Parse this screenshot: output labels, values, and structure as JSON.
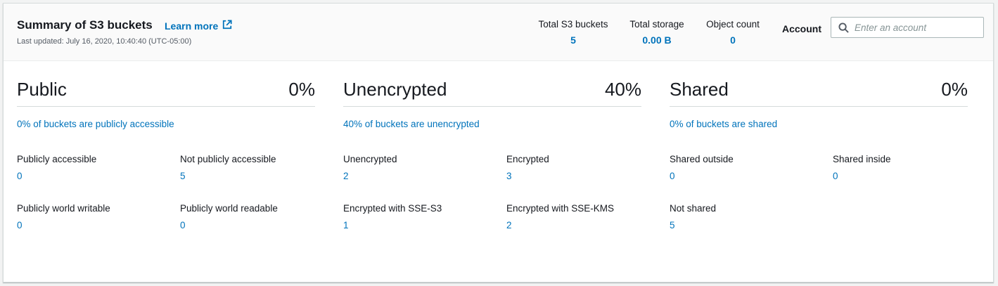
{
  "header": {
    "title": "Summary of S3 buckets",
    "learn_more": "Learn more",
    "last_updated": "Last updated: July 16, 2020, 10:40:40 (UTC-05:00)",
    "stats": [
      {
        "label": "Total S3 buckets",
        "value": "5"
      },
      {
        "label": "Total storage",
        "value": "0.00 B"
      },
      {
        "label": "Object count",
        "value": "0"
      }
    ],
    "account_label": "Account",
    "account_placeholder": "Enter an account",
    "account_value": ""
  },
  "sections": [
    {
      "title": "Public",
      "percent": "0%",
      "link": "0% of buckets are publicly accessible",
      "metrics": [
        {
          "label": "Publicly accessible",
          "value": "0"
        },
        {
          "label": "Not publicly accessible",
          "value": "5"
        },
        {
          "label": "Publicly world writable",
          "value": "0"
        },
        {
          "label": "Publicly world readable",
          "value": "0"
        }
      ]
    },
    {
      "title": "Unencrypted",
      "percent": "40%",
      "link": "40% of buckets are unencrypted",
      "metrics": [
        {
          "label": "Unencrypted",
          "value": "2"
        },
        {
          "label": "Encrypted",
          "value": "3"
        },
        {
          "label": "Encrypted with SSE-S3",
          "value": "1"
        },
        {
          "label": "Encrypted with SSE-KMS",
          "value": "2"
        }
      ]
    },
    {
      "title": "Shared",
      "percent": "0%",
      "link": "0% of buckets are shared",
      "metrics": [
        {
          "label": "Shared outside",
          "value": "0"
        },
        {
          "label": "Shared inside",
          "value": "0"
        },
        {
          "label": "Not shared",
          "value": "5"
        }
      ]
    }
  ],
  "icons": {
    "external_link": "external-link-icon",
    "search": "search-icon"
  },
  "colors": {
    "link": "#0073bb",
    "text": "#16191f",
    "secondary_text": "#545b64",
    "header_bg": "#fafafa",
    "border": "#d5dbdb"
  }
}
